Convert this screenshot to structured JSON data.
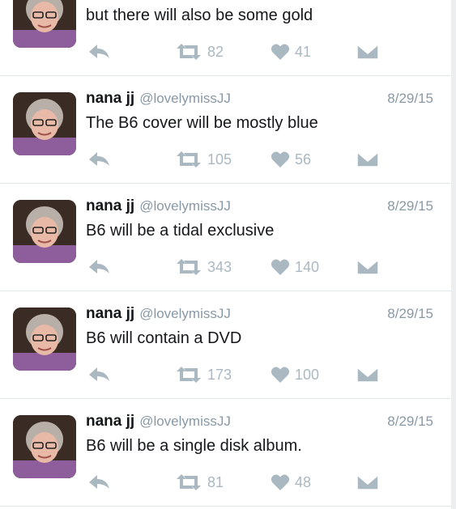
{
  "tweets": [
    {
      "name": "",
      "handle": "",
      "date": "",
      "text": "but there will also be some gold",
      "retweets": "82",
      "likes": "41"
    },
    {
      "name": "nana jj",
      "handle": "@lovelymissJJ",
      "date": "8/29/15",
      "text": "The B6 cover will be mostly blue",
      "retweets": "105",
      "likes": "56"
    },
    {
      "name": "nana jj",
      "handle": "@lovelymissJJ",
      "date": "8/29/15",
      "text": "B6 will be a tidal exclusive",
      "retweets": "343",
      "likes": "140"
    },
    {
      "name": "nana jj",
      "handle": "@lovelymissJJ",
      "date": "8/29/15",
      "text": "B6 will contain a DVD",
      "retweets": "173",
      "likes": "100"
    },
    {
      "name": "nana jj",
      "handle": "@lovelymissJJ",
      "date": "8/29/15",
      "text": "B6 will be a single disk album.",
      "retweets": "81",
      "likes": "48"
    }
  ],
  "colors": {
    "text": "#14171a",
    "muted": "#8899a6",
    "icon": "#aab8c2",
    "divider": "#e1e8ed"
  },
  "icons": [
    "reply-icon",
    "retweet-icon",
    "like-icon",
    "direct-message-icon"
  ]
}
